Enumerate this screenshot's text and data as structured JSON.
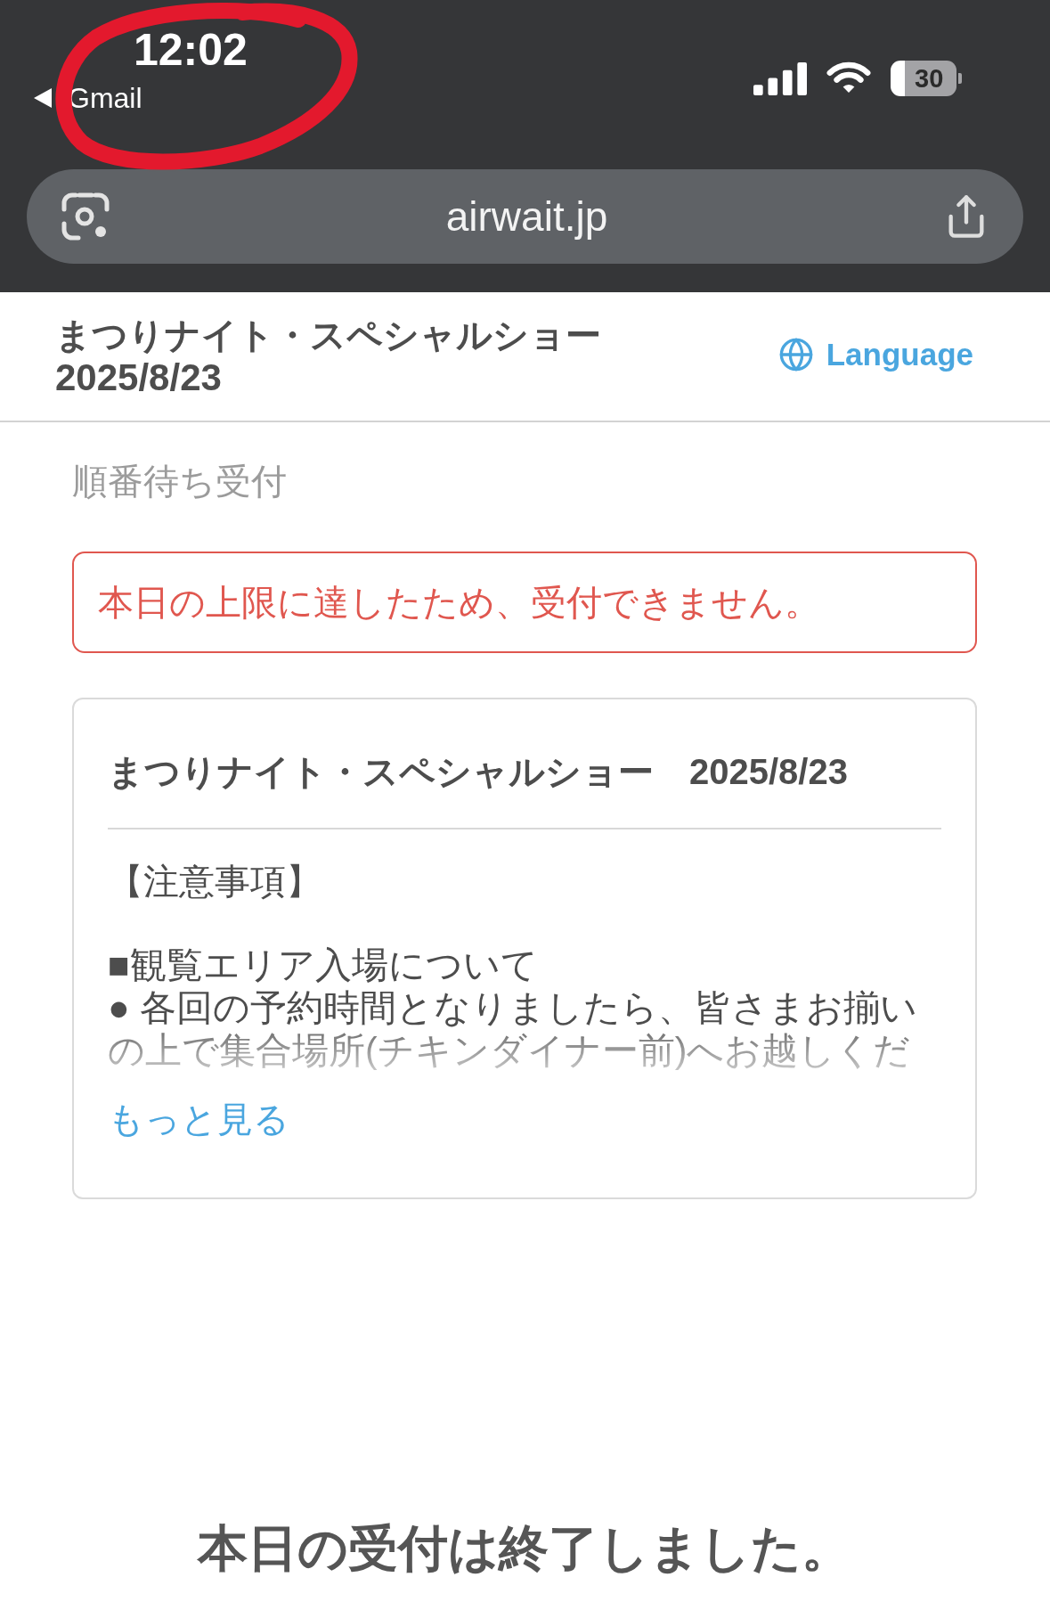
{
  "status_bar": {
    "time": "12:02",
    "back_label": "Gmail",
    "battery": "30"
  },
  "browser": {
    "url": "airwait.jp"
  },
  "header": {
    "title": "まつりナイト・スペシャルショー",
    "date": "2025/8/23",
    "language_link": "Language"
  },
  "section_label": "順番待ち受付",
  "alert": "本日の上限に達したため、受付できません。",
  "event_card": {
    "title": "まつりナイト・スペシャルショー　2025/8/23",
    "notice_heading": "【注意事項】",
    "notice_lines": [
      "■観覧エリア入場について",
      "● 各回の予約時間となりましたら、皆さまお揃いの上で集合場所(チキンダイナー前)へお越しくだ"
    ],
    "expanded": false,
    "more_link": "もっと見る"
  },
  "closed_message": "本日の受付は終了しました。"
}
